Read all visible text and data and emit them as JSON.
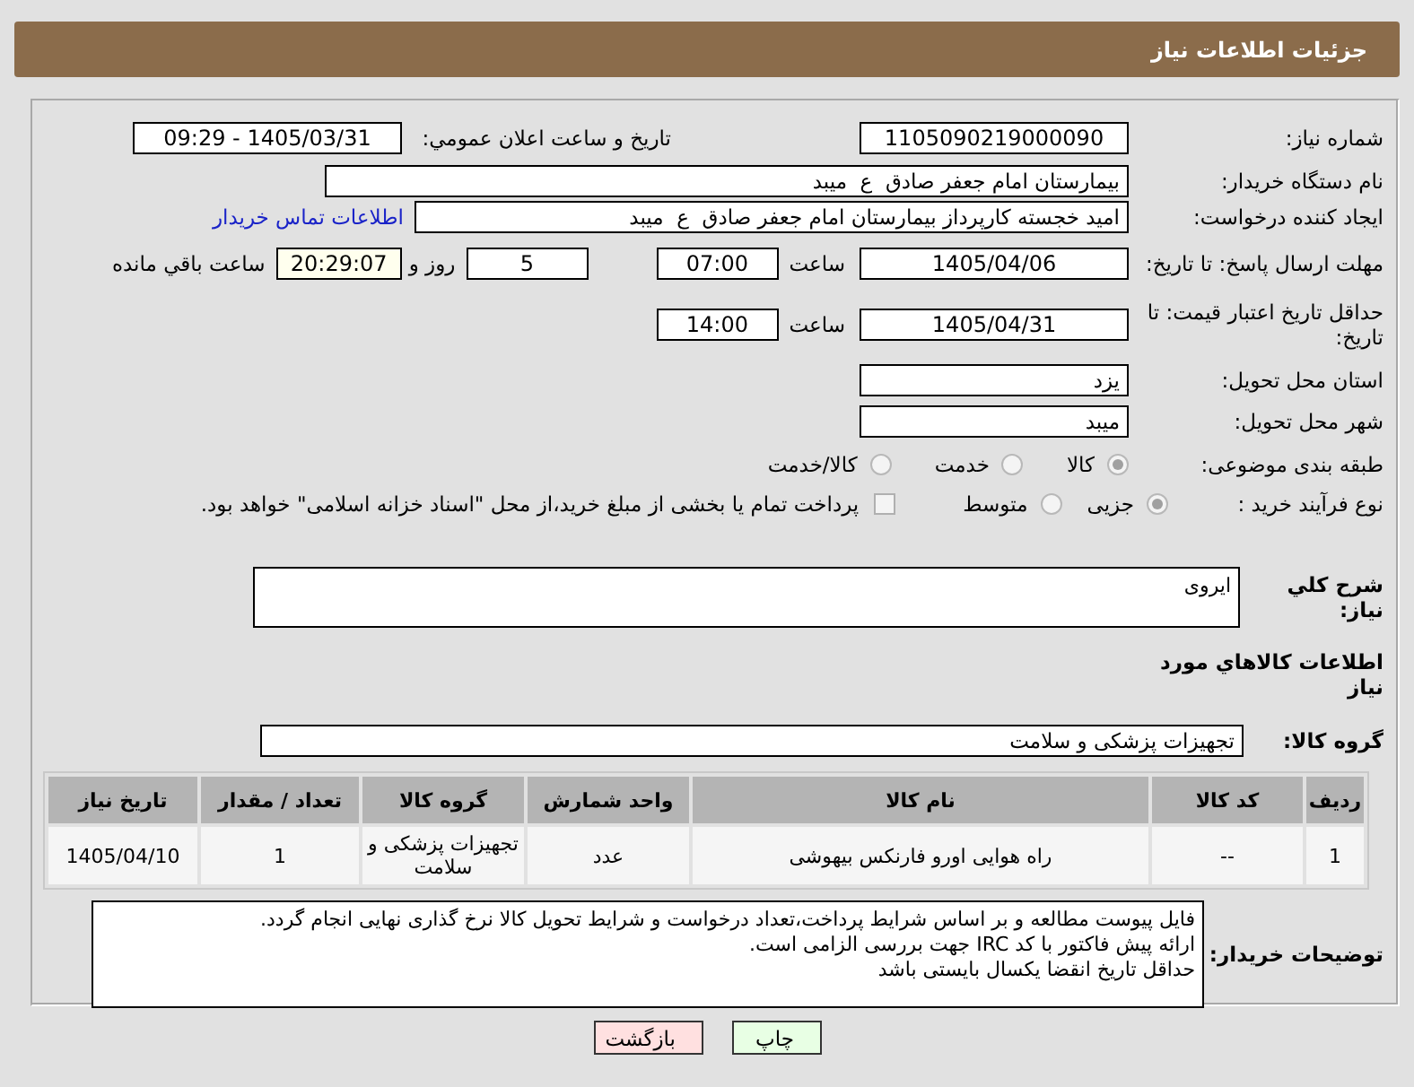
{
  "header": {
    "title": "جزئیات اطلاعات نیاز"
  },
  "need_number": {
    "label": "شماره نیاز:",
    "value": "1105090219000090"
  },
  "announce": {
    "label": "تاریخ و ساعت اعلان عمومي:",
    "value": "1405/03/31 - 09:29"
  },
  "buyer": {
    "label": "نام دستگاه خریدار:",
    "value": "بیمارستان امام جعفر صادق  ع  میبد"
  },
  "creator": {
    "label": "ایجاد کننده درخواست:",
    "value": "امید خجسته کارپرداز بیمارستان امام جعفر صادق  ع  میبد",
    "link": "اطلاعات تماس خریدار"
  },
  "deadline": {
    "label": "مهلت ارسال پاسخ: تا تاریخ:",
    "date": "1405/04/06",
    "time_label": "ساعت",
    "time": "07:00",
    "days": "5",
    "days_label": "روز و",
    "remaining": "20:29:07",
    "remaining_label": "ساعت باقي مانده"
  },
  "validity": {
    "label": "حداقل تاریخ اعتبار قیمت: تا تاریخ:",
    "date": "1405/04/31",
    "time_label": "ساعت",
    "time": "14:00"
  },
  "province": {
    "label": "استان محل تحویل:",
    "value": "یزد"
  },
  "city": {
    "label": "شهر محل تحویل:",
    "value": "میبد"
  },
  "category": {
    "label": "طبقه بندی موضوعی:",
    "options": [
      {
        "label": "کالا",
        "selected": true
      },
      {
        "label": "خدمت",
        "selected": false
      },
      {
        "label": "کالا/خدمت",
        "selected": false
      }
    ]
  },
  "process": {
    "label": "نوع فرآیند خرید :",
    "options": [
      {
        "label": "جزیی",
        "selected": true
      },
      {
        "label": "متوسط",
        "selected": false
      }
    ],
    "payment": {
      "label": "پرداخت تمام یا بخشی از مبلغ خرید،از محل \"اسناد خزانه اسلامی\" خواهد بود.",
      "checked": false
    }
  },
  "description": {
    "label": "شرح کلي نیاز:",
    "value": "ایروی"
  },
  "items_title": "اطلاعات کالاهاي مورد نیاز",
  "goods_group": {
    "label": "گروه کالا:",
    "value": "تجهیزات پزشکی و سلامت"
  },
  "table": {
    "columns": [
      "ردیف",
      "کد کالا",
      "نام کالا",
      "واحد شمارش",
      "گروه کالا",
      "تعداد / مقدار",
      "تاریخ نیاز"
    ],
    "rows": [
      [
        "1",
        "--",
        "راه هوایی اورو فارنکس بیهوشی",
        "عدد",
        "تجهیزات پزشکی و سلامت",
        "1",
        "1405/04/10"
      ]
    ]
  },
  "notes": {
    "label": "توضیحات خریدار:",
    "lines": [
      "فایل پیوست مطالعه و بر اساس شرایط پرداخت،تعداد درخواست و شرایط تحویل کالا نرخ گذاری نهایی انجام گردد.",
      "ارائه پیش فاکتور با کد IRC جهت بررسی الزامی است.",
      "حداقل تاریخ انقضا یکسال بایستی باشد"
    ]
  },
  "buttons": [
    {
      "label": "چاپ",
      "kind": "print"
    },
    {
      "label": "بازگشت",
      "kind": "back"
    }
  ]
}
